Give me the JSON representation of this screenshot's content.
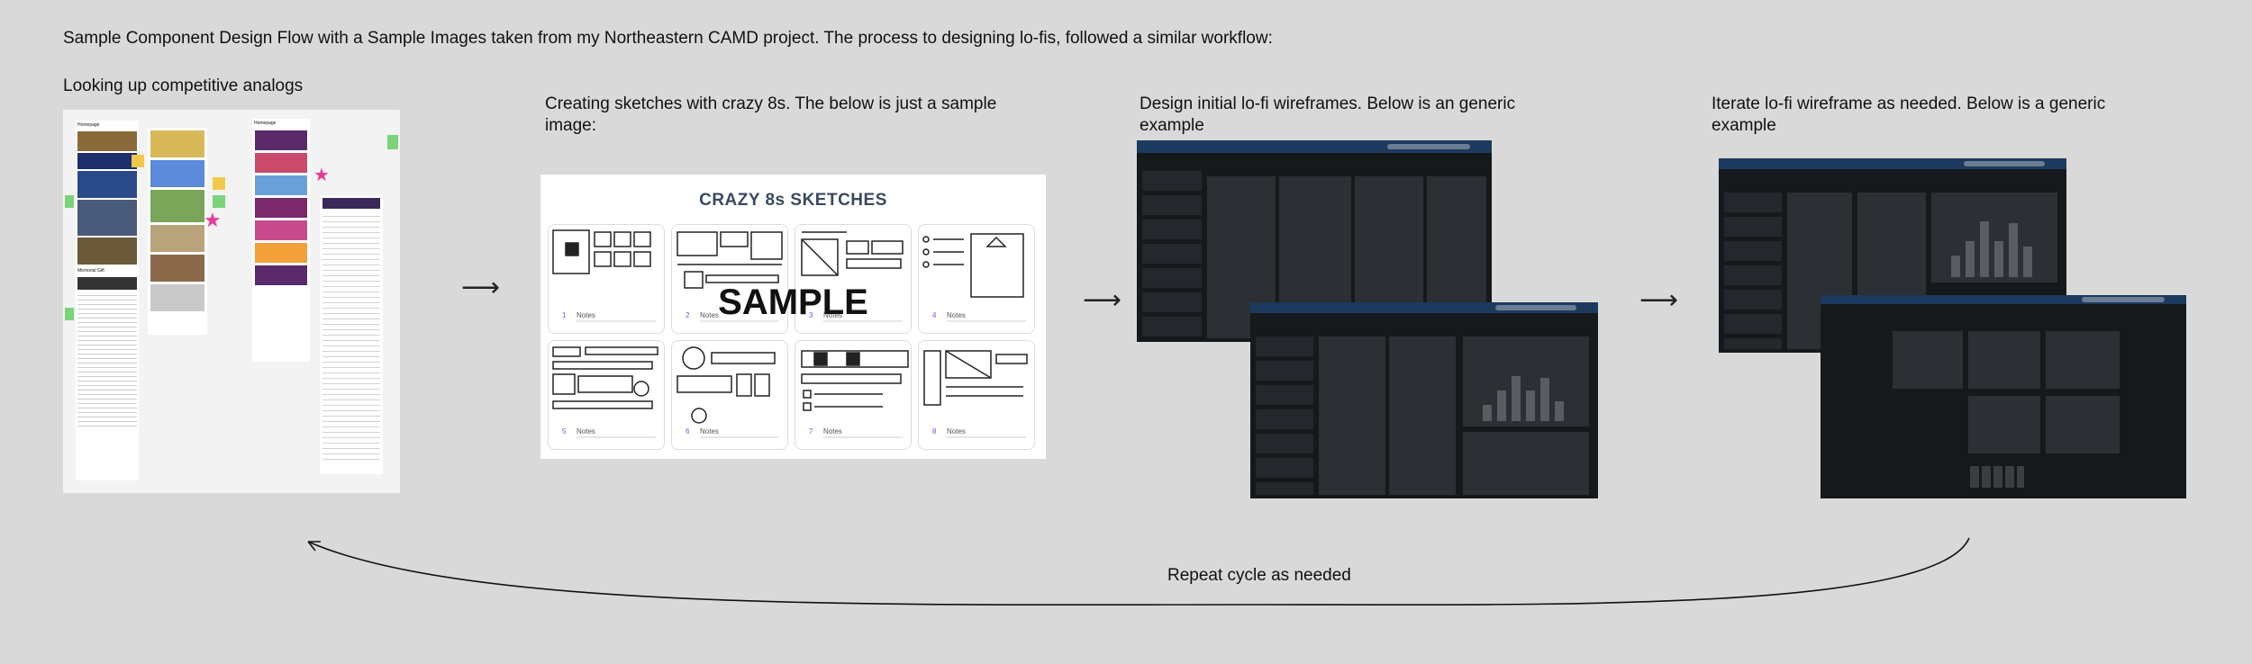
{
  "intro": "Sample Component Design Flow with a Sample Images taken from my Northeastern CAMD project. The process to designing lo-fis, followed a similar workflow:",
  "steps": [
    {
      "label": "Looking up competitive analogs"
    },
    {
      "label": "Creating sketches with crazy 8s. The below is just a sample image:"
    },
    {
      "label": "Design initial lo-fi wireframes. Below is an generic example"
    },
    {
      "label": "Iterate lo-fi wireframe as needed. Below is a generic example"
    }
  ],
  "analog_image": {
    "header_left": "Homepage",
    "header_right": "Homepage",
    "section": "Memorial Gift"
  },
  "sketch": {
    "title": "CRAZY 8s SKETCHES",
    "watermark": "SAMPLE",
    "cells": [
      {
        "num": "1",
        "notes": "Notes"
      },
      {
        "num": "2",
        "notes": "Notes"
      },
      {
        "num": "3",
        "notes": "Notes"
      },
      {
        "num": "4",
        "notes": "Notes"
      },
      {
        "num": "5",
        "notes": "Notes"
      },
      {
        "num": "6",
        "notes": "Notes"
      },
      {
        "num": "7",
        "notes": "Notes"
      },
      {
        "num": "8",
        "notes": "Notes"
      }
    ]
  },
  "arrow_glyph": "⟶",
  "loop_label": "Repeat cycle as needed",
  "colors": {
    "background": "#d9d9d9",
    "wireframe_dark": "#16191c",
    "wireframe_card": "#2c2f33",
    "wireframe_header": "#1c3a5e"
  }
}
